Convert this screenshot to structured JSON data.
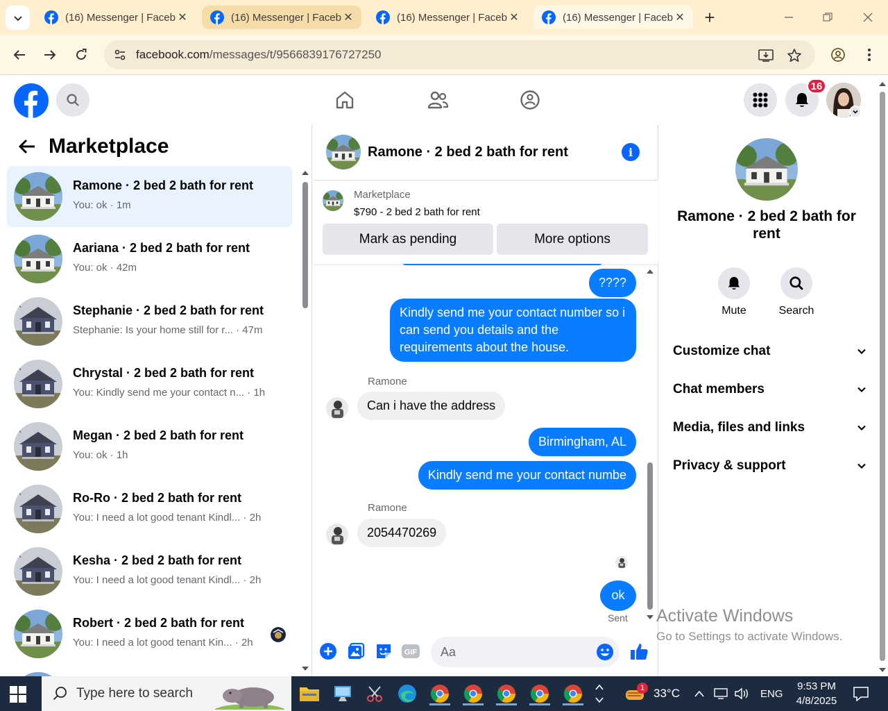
{
  "browser": {
    "tabs": [
      {
        "label": "(16) Messenger | Faceb"
      },
      {
        "label": "(16) Messenger | Faceb"
      },
      {
        "label": "(16) Messenger | Faceb"
      },
      {
        "label": "(16) Messenger | Faceb"
      }
    ],
    "url_host": "facebook.com",
    "url_path": "/messages/t/9566839176727250"
  },
  "header": {
    "notification_count": "16"
  },
  "left_panel": {
    "title": "Marketplace",
    "conversations": [
      {
        "name": "Ramone · 2 bed 2 bath for rent",
        "snippet": "You: ok · 1m",
        "house": "white"
      },
      {
        "name": "Aariana · 2 bed 2 bath for rent",
        "snippet": "You: ok · 42m",
        "house": "white"
      },
      {
        "name": "Stephanie · 2 bed 2 bath for rent",
        "snippet": "Stephanie: Is your home still for r... · 47m",
        "house": "blue"
      },
      {
        "name": "Chrystal · 2 bed 2 bath for rent",
        "snippet": "You: Kindly send me your contact n... · 1h",
        "house": "blue"
      },
      {
        "name": "Megan · 2 bed 2 bath for rent",
        "snippet": "You: ok · 1h",
        "house": "blue"
      },
      {
        "name": "Ro-Ro · 2 bed 2 bath for rent",
        "snippet": "You: I need a lot good tenant Kindl... · 2h",
        "house": "blue"
      },
      {
        "name": "Kesha · 2 bed 2 bath for rent",
        "snippet": "You: I need a lot good tenant Kindl... · 2h",
        "house": "blue"
      },
      {
        "name": "Robert · 2 bed 2 bath for rent",
        "snippet": "You: I need a lot good tenant Kin... · 2h",
        "house": "white"
      }
    ]
  },
  "chat": {
    "title": "Ramone · 2 bed 2 bath for rent",
    "listing": {
      "source": "Marketplace",
      "price_title": "$790 - 2 bed 2 bath for rent",
      "mark_pending_label": "Mark as pending",
      "more_options_label": "More options"
    },
    "messages": [
      {
        "from": "me",
        "text": "????"
      },
      {
        "from": "me",
        "text": "Kindly send me your contact number so i can send you details and the requirements about the house."
      },
      {
        "from": "Ramone",
        "text": "Can i have the address"
      },
      {
        "from": "me",
        "text": "Birmingham, AL"
      },
      {
        "from": "me",
        "text": "Kindly send me your contact numbe"
      },
      {
        "from": "Ramone",
        "text": "2054470269"
      },
      {
        "from": "me",
        "text": "ok"
      }
    ],
    "sender_name": "Ramone",
    "sent_status": "Sent",
    "composer_placeholder": "Aa"
  },
  "right_panel": {
    "name": "Ramone · 2 bed 2 bath for rent",
    "mute_label": "Mute",
    "search_label": "Search",
    "sections": [
      "Customize chat",
      "Chat members",
      "Media, files and links",
      "Privacy & support"
    ]
  },
  "watermark": {
    "line1": "Activate Windows",
    "line2": "Go to Settings to activate Windows."
  },
  "taskbar": {
    "search_placeholder": "Type here to search",
    "temperature": "33°C",
    "weather_badge": "1",
    "language": "ENG",
    "time": "9:53 PM",
    "date": "4/8/2025"
  },
  "colors": {
    "fb_blue": "#0866ff",
    "bubble_blue": "#0a7cff",
    "selected_row": "#e8f3ff",
    "tabbar": "#ffefce"
  }
}
